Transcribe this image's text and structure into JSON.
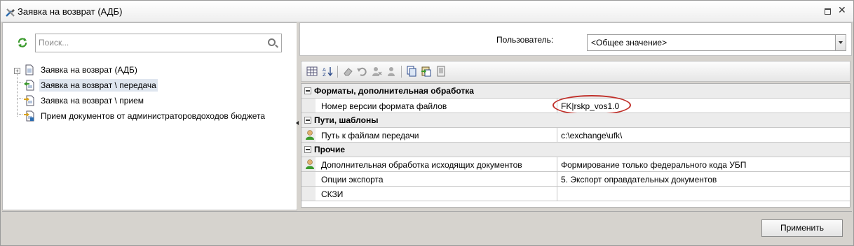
{
  "window": {
    "title": "Заявка на возврат (АДБ)"
  },
  "left_panel": {
    "search": {
      "placeholder": "Поиск...",
      "value": ""
    },
    "tree": [
      {
        "label": "Заявка на возврат (АДБ)",
        "expandable": true,
        "expander_glyph": "+",
        "selected": false
      },
      {
        "label": "Заявка на возврат \\ передача",
        "selected": true
      },
      {
        "label": "Заявка на возврат \\ прием",
        "selected": false
      },
      {
        "label": "Прием документов от администраторовдоходов бюджета",
        "selected": false
      }
    ]
  },
  "right_panel": {
    "user_label": "Пользователь:",
    "user_select_value": "<Общее значение>",
    "toolbar": [
      "grid-view-icon",
      "sort-az-icon",
      "eraser-icon",
      "undo-icon",
      "delete-user-icon",
      "user-icon",
      "copy-icon",
      "paste-icon",
      "notes-icon"
    ],
    "property_grid": {
      "categories": [
        {
          "label": "Форматы, дополнительная обработка",
          "rows": [
            {
              "name": "Номер версии формата файлов",
              "value": "FK|rskp_vos1.0",
              "icon": "",
              "highlighted": true
            }
          ]
        },
        {
          "label": "Пути, шаблоны",
          "rows": [
            {
              "name": "Путь к файлам передачи",
              "value": "c:\\exchange\\ufk\\",
              "icon": "person-icon"
            }
          ]
        },
        {
          "label": "Прочие",
          "rows": [
            {
              "name": "Дополнительная обработка исходящих документов",
              "value": "Формирование только федерального кода УБП",
              "icon": "person-icon"
            },
            {
              "name": "Опции экспорта",
              "value": "5. Экспорт оправдательных документов",
              "icon": ""
            },
            {
              "name": "СКЗИ",
              "value": "",
              "icon": ""
            }
          ]
        }
      ]
    }
  },
  "footer": {
    "apply_label": "Применить"
  },
  "colors": {
    "window_bg": "#d6d3ce",
    "selection_bg": "#dfe6ef",
    "highlight_ellipse": "#c0302a"
  }
}
